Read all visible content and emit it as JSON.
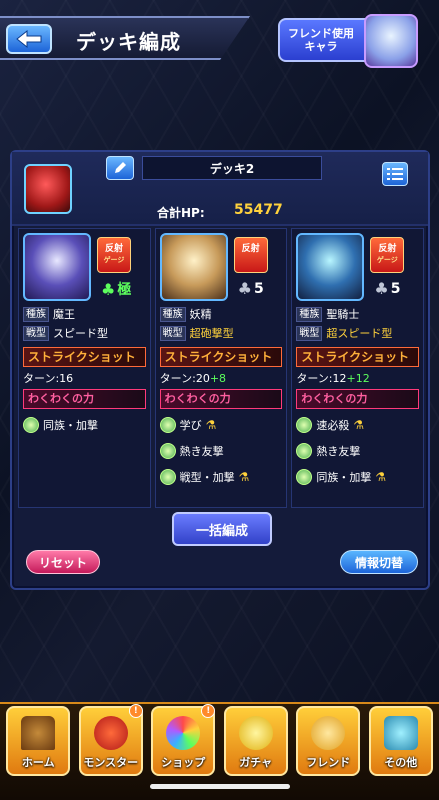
{
  "header": {
    "title": "デッキ編成",
    "friend_button": "フレンド使用キャラ"
  },
  "deck": {
    "name": "デッキ2",
    "hp_label": "合計HP:",
    "hp_value": "55477"
  },
  "monsters": [
    {
      "gauge_label": "反射",
      "gauge_sub": "ゲージ",
      "luck": "極",
      "luck_is_max": true,
      "tribe_tag": "種族",
      "tribe": "魔王",
      "type_tag": "戦型",
      "type": "スピード型",
      "type_gold": false,
      "strike_shot": "ストライクショット",
      "turn_label": "ターン:16",
      "turn_plus": "",
      "waku_title": "わくわくの力",
      "waku": [
        "同族・加撃"
      ]
    },
    {
      "gauge_label": "反射",
      "gauge_sub": "",
      "luck": "5",
      "luck_is_max": false,
      "tribe_tag": "種族",
      "tribe": "妖精",
      "type_tag": "戦型",
      "type": "超砲撃型",
      "type_gold": true,
      "strike_shot": "ストライクショット",
      "turn_label": "ターン:20",
      "turn_plus": "+8",
      "waku_title": "わくわくの力",
      "waku": [
        "学び",
        "熱き友撃",
        "戦型・加撃"
      ]
    },
    {
      "gauge_label": "反射",
      "gauge_sub": "ゲージ",
      "luck": "5",
      "luck_is_max": false,
      "tribe_tag": "種族",
      "tribe": "聖騎士",
      "type_tag": "戦型",
      "type": "超スピード型",
      "type_gold": true,
      "strike_shot": "ストライクショット",
      "turn_label": "ターン:12",
      "turn_plus": "+12",
      "waku_title": "わくわくの力",
      "waku": [
        "速必殺",
        "熱き友撃",
        "同族・加撃"
      ]
    }
  ],
  "buttons": {
    "bulk_edit": "一括編成",
    "reset": "リセット",
    "info_toggle": "情報切替"
  },
  "nav": [
    {
      "label": "ホーム",
      "icon": "home-icon",
      "badge": ""
    },
    {
      "label": "モンスター",
      "icon": "monster-icon",
      "badge": "!"
    },
    {
      "label": "ショップ",
      "icon": "shop-orb-icon",
      "badge": "!"
    },
    {
      "label": "ガチャ",
      "icon": "gacha-icon",
      "badge": ""
    },
    {
      "label": "フレンド",
      "icon": "friend-icon",
      "badge": ""
    },
    {
      "label": "その他",
      "icon": "other-icon",
      "badge": ""
    }
  ]
}
